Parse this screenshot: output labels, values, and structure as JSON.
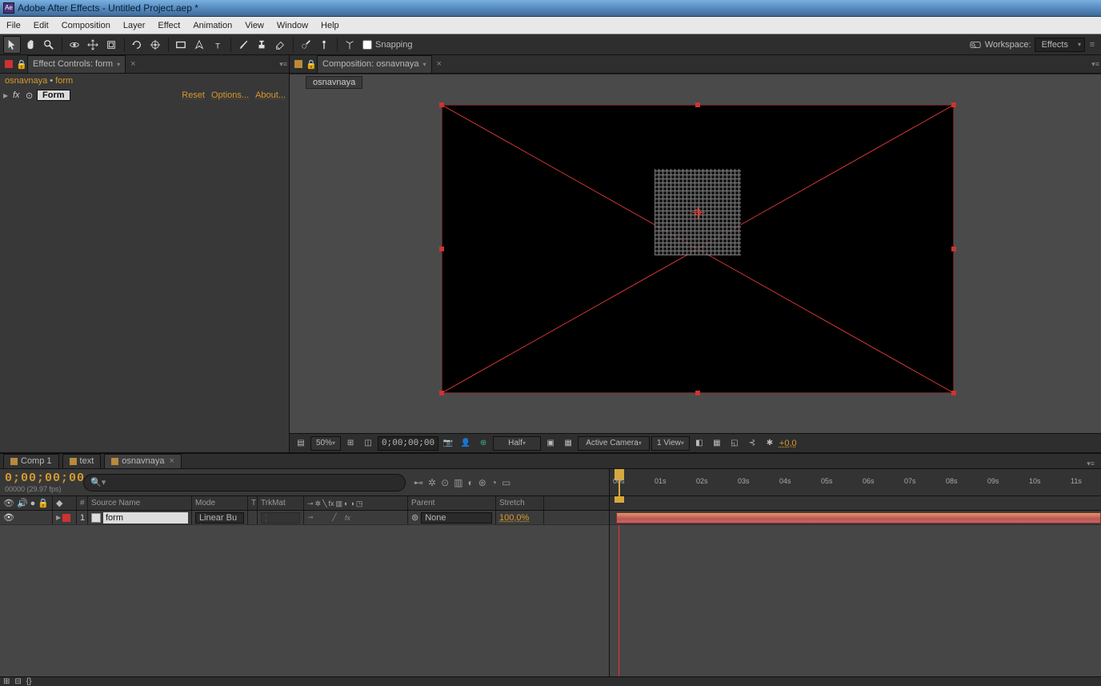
{
  "title": "Adobe After Effects - Untitled Project.aep *",
  "menu": [
    "File",
    "Edit",
    "Composition",
    "Layer",
    "Effect",
    "Animation",
    "View",
    "Window",
    "Help"
  ],
  "toolbar": {
    "snapping_label": "Snapping",
    "workspace_label": "Workspace:",
    "workspace_value": "Effects"
  },
  "effect_controls": {
    "tab": "Effect Controls: form",
    "crumb_comp": "osnavnaya",
    "crumb_layer": "form",
    "effect_name": "Form",
    "links": [
      "Reset",
      "Options...",
      "About..."
    ]
  },
  "composition": {
    "tab": "Composition: osnavnaya",
    "subtab": "osnavnaya",
    "footer": {
      "magnification": "50%",
      "timecode": "0;00;00;00",
      "resolution": "Half",
      "camera": "Active Camera",
      "views": "1 View",
      "exposure": "+0,0"
    }
  },
  "timeline": {
    "tabs": [
      {
        "label": "Comp 1",
        "active": false
      },
      {
        "label": "text",
        "active": false
      },
      {
        "label": "osnavnaya",
        "active": true
      }
    ],
    "current_time": "0;00;00;00",
    "frame_info": "00000 (29.97 fps)",
    "search_placeholder": "",
    "columns": {
      "num": "#",
      "source": "Source Name",
      "mode": "Mode",
      "t": "T",
      "trkmat": "TrkMat",
      "parent": "Parent",
      "stretch": "Stretch"
    },
    "layer": {
      "index": "1",
      "name": "form",
      "mode": "Linear Bu",
      "parent": "None",
      "stretch": "100,0%"
    },
    "ruler": [
      "00s",
      "01s",
      "02s",
      "03s",
      "04s",
      "05s",
      "06s",
      "07s",
      "08s",
      "09s",
      "10s",
      "11s"
    ]
  }
}
